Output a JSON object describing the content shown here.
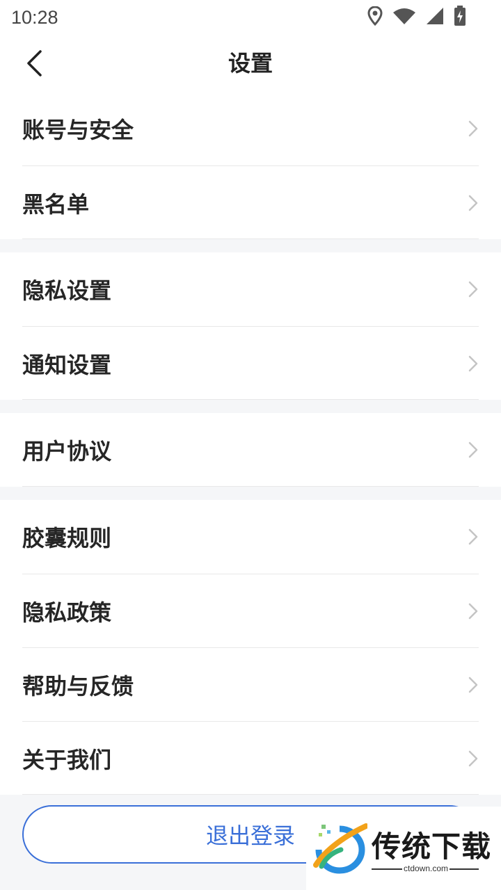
{
  "status_bar": {
    "time": "10:28",
    "icons": [
      "location-icon",
      "wifi-icon",
      "signal-icon",
      "battery-charging-icon"
    ]
  },
  "header": {
    "title": "设置",
    "back_icon": "chevron-left-icon"
  },
  "groups": [
    {
      "items": [
        {
          "label": "账号与安全"
        },
        {
          "label": "黑名单"
        }
      ]
    },
    {
      "items": [
        {
          "label": "隐私设置"
        },
        {
          "label": "通知设置"
        }
      ]
    },
    {
      "items": [
        {
          "label": "用户协议"
        }
      ]
    },
    {
      "items": [
        {
          "label": "胶囊规则"
        },
        {
          "label": "隐私政策"
        },
        {
          "label": "帮助与反馈"
        },
        {
          "label": "关于我们"
        }
      ]
    }
  ],
  "logout": {
    "label": "退出登录"
  },
  "watermark": {
    "title": "传统下载",
    "domain": "ctdown.com"
  },
  "colors": {
    "accent": "#3a6fd8",
    "text": "#262626",
    "chevron": "#c4c4c4",
    "background": "#f5f6f8"
  }
}
